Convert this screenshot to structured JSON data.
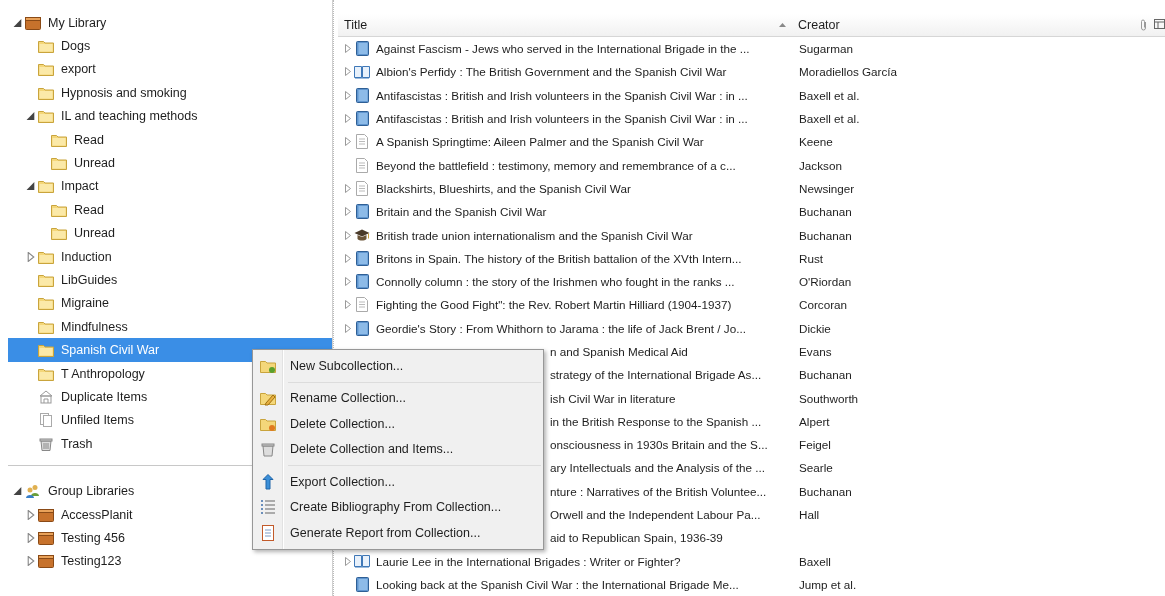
{
  "sidebar": {
    "libraries": [
      {
        "label": "My Library",
        "kind": "library",
        "selected": false,
        "expanded": true,
        "children": [
          {
            "label": "Dogs",
            "kind": "folder",
            "selected": false
          },
          {
            "label": "export",
            "kind": "folder",
            "selected": false
          },
          {
            "label": "Hypnosis and smoking",
            "kind": "folder",
            "selected": false
          },
          {
            "label": "IL and teaching methods",
            "kind": "folder",
            "selected": false,
            "expanded": true,
            "children": [
              {
                "label": "Read",
                "kind": "folder",
                "selected": false
              },
              {
                "label": "Unread",
                "kind": "folder",
                "selected": false
              }
            ]
          },
          {
            "label": "Impact",
            "kind": "folder",
            "selected": false,
            "expanded": true,
            "children": [
              {
                "label": "Read",
                "kind": "folder",
                "selected": false
              },
              {
                "label": "Unread",
                "kind": "folder",
                "selected": false
              }
            ]
          },
          {
            "label": "Induction",
            "kind": "folder",
            "selected": false,
            "expanded": false
          },
          {
            "label": "LibGuides",
            "kind": "folder",
            "selected": false
          },
          {
            "label": "Migraine",
            "kind": "folder",
            "selected": false
          },
          {
            "label": "Mindfulness",
            "kind": "folder",
            "selected": false
          },
          {
            "label": "Spanish Civil War",
            "kind": "folder",
            "selected": true
          },
          {
            "label": "T Anthropology",
            "kind": "folder",
            "selected": false
          },
          {
            "label": "Duplicate Items",
            "kind": "duplicates",
            "selected": false
          },
          {
            "label": "Unfiled Items",
            "kind": "unfiled",
            "selected": false
          },
          {
            "label": "Trash",
            "kind": "trash",
            "selected": false
          }
        ]
      }
    ],
    "group_libraries": [
      {
        "label": "Group Libraries",
        "kind": "group",
        "selected": false,
        "expanded": true,
        "children": [
          {
            "label": "AccessPlanit",
            "kind": "library",
            "selected": false,
            "expanded": false
          },
          {
            "label": "Testing 456",
            "kind": "library",
            "selected": false,
            "expanded": false
          },
          {
            "label": "Testing123",
            "kind": "library",
            "selected": false,
            "expanded": false
          }
        ]
      }
    ]
  },
  "table": {
    "columns": [
      "Title",
      "Creator"
    ],
    "rows": [
      {
        "title": "Against Fascism - Jews who served in the International Brigade in the ...",
        "creator": "Sugarman",
        "kind": "book",
        "expandable": true
      },
      {
        "title": "Albion's Perfidy : The British Government and the Spanish Civil War",
        "creator": "Moradiellos García",
        "kind": "book-section",
        "expandable": true
      },
      {
        "title": "Antifascistas : British and Irish volunteers in the Spanish Civil War : in ...",
        "creator": "Baxell et al.",
        "kind": "book",
        "expandable": true
      },
      {
        "title": "Antifascistas : British and Irish volunteers in the Spanish Civil War : in ...",
        "creator": "Baxell et al.",
        "kind": "book",
        "expandable": true
      },
      {
        "title": "A Spanish Springtime: Aileen Palmer and the Spanish Civil War",
        "creator": "Keene",
        "kind": "document",
        "expandable": true
      },
      {
        "title": "Beyond the battlefield : testimony, memory and remembrance of a c...",
        "creator": "Jackson",
        "kind": "document",
        "expandable": false
      },
      {
        "title": "Blackshirts, Blueshirts, and the Spanish Civil War",
        "creator": "Newsinger",
        "kind": "document",
        "expandable": true
      },
      {
        "title": "Britain and the Spanish Civil War",
        "creator": "Buchanan",
        "kind": "book",
        "expandable": true
      },
      {
        "title": "British trade union internationalism and the Spanish Civil War",
        "creator": "Buchanan",
        "kind": "thesis",
        "expandable": true
      },
      {
        "title": "Britons in Spain. The history of the British battalion of the XVth Intern...",
        "creator": "Rust",
        "kind": "book",
        "expandable": true
      },
      {
        "title": "Connolly column : the story of the Irishmen who fought in the ranks ...",
        "creator": "O'Riordan",
        "kind": "book",
        "expandable": true
      },
      {
        "title": "Fighting the Good Fight\": the Rev. Robert Martin Hilliard (1904-1937)",
        "creator": "Corcoran",
        "kind": "document",
        "expandable": true
      },
      {
        "title": "Geordie's Story : From Whithorn to Jarama : the life of Jack Brent / Jo...",
        "creator": "Dickie",
        "kind": "book",
        "expandable": true
      },
      {
        "title": "n and Spanish Medical Aid",
        "creator": "Evans",
        "kind": "covered"
      },
      {
        "title": "strategy of the International Brigade As...",
        "creator": "Buchanan",
        "kind": "covered"
      },
      {
        "title": "ish Civil War in literature",
        "creator": "Southworth",
        "kind": "covered"
      },
      {
        "title": "in the British Response to the Spanish ...",
        "creator": "Alpert",
        "kind": "covered"
      },
      {
        "title": "onsciousness in 1930s Britain and the S...",
        "creator": "Feigel",
        "kind": "covered"
      },
      {
        "title": "ary Intellectuals and the Analysis of the ...",
        "creator": "Searle",
        "kind": "covered"
      },
      {
        "title": "nture : Narratives of the British Voluntee...",
        "creator": "Buchanan",
        "kind": "covered"
      },
      {
        "title": "Orwell and the Independent Labour Pa...",
        "creator": "Hall",
        "kind": "covered"
      },
      {
        "title": "aid to Republican Spain, 1936-39",
        "kind": "covered"
      },
      {
        "title": "Laurie Lee in the International Brigades : Writer or Fighter?",
        "creator": "Baxell",
        "kind": "book-section",
        "expandable": true
      },
      {
        "title": "Looking back at the Spanish Civil War : the International Brigade Me...",
        "creator": "Jump et al.",
        "kind": "book",
        "expandable": false
      }
    ]
  },
  "context_menu": {
    "groups": [
      [
        {
          "label": "New Subcollection...",
          "kind": "new-subcollection"
        }
      ],
      [
        {
          "label": "Rename Collection...",
          "kind": "rename"
        },
        {
          "label": "Delete Collection...",
          "kind": "delete"
        },
        {
          "label": "Delete Collection and Items...",
          "kind": "delete-items"
        }
      ],
      [
        {
          "label": "Export Collection...",
          "kind": "export"
        },
        {
          "label": "Create Bibliography From Collection...",
          "kind": "bibliography"
        },
        {
          "label": "Generate Report from Collection...",
          "kind": "report"
        }
      ]
    ]
  }
}
